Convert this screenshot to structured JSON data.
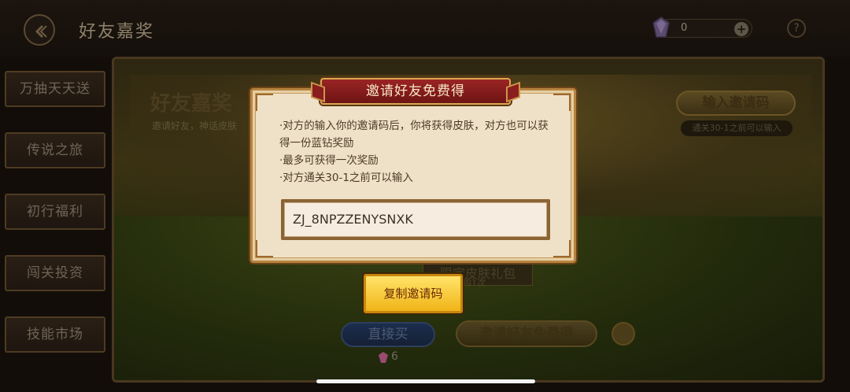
{
  "header": {
    "title": "好友嘉奖",
    "gem_count": "0",
    "help_symbol": "?"
  },
  "sidebar": {
    "items": [
      {
        "label": "万抽天天送"
      },
      {
        "label": "传说之旅"
      },
      {
        "label": "初行福利"
      },
      {
        "label": "闯关投资"
      },
      {
        "label": "技能市场"
      }
    ]
  },
  "main": {
    "title": "好友嘉奖",
    "subtitle": "邀请好友，神话皮肤",
    "enter_code_button": "输入邀请码",
    "enter_code_hint": "通关30-1之前可以输入",
    "card_title": "限定皮肤礼包",
    "card_sub": "限购1次",
    "buy_direct_button": "直接买",
    "invite_free_button": "邀请好友免费得",
    "cost": "6"
  },
  "modal": {
    "title": "邀请好友免费得",
    "rules": [
      "·对方的输入你的邀请码后，你将获得皮肤，对方也可以获得一份蓝钻奖励",
      "·最多可获得一次奖励",
      "·对方通关30-1之前可以输入"
    ],
    "invite_code": "ZJ_8NPZZENYSNXK",
    "copy_button": "复制邀请码"
  },
  "colors": {
    "accent_gold": "#f1b417",
    "banner_red": "#9a2424",
    "panel_bg": "#efe1c7"
  }
}
